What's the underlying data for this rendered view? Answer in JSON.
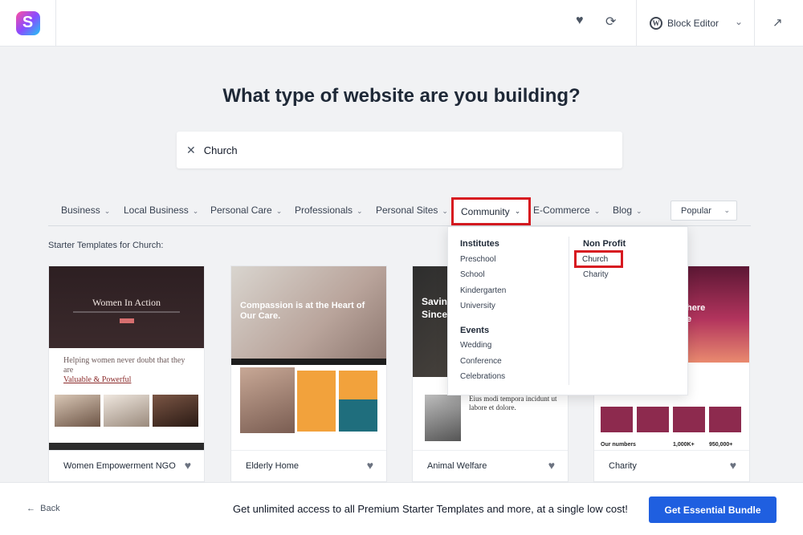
{
  "header": {
    "logo_letter": "S",
    "editor_label": "Block Editor",
    "icons": [
      "heart-icon",
      "sync-icon",
      "wordpress-icon",
      "chevron-down-icon",
      "external-link-icon"
    ]
  },
  "main": {
    "title": "What type of website are you building?",
    "search": {
      "value": "Church",
      "clear_icon": "close-icon"
    }
  },
  "categories": [
    {
      "label": "Business"
    },
    {
      "label": "Local Business"
    },
    {
      "label": "Personal Care"
    },
    {
      "label": "Professionals"
    },
    {
      "label": "Personal Sites"
    },
    {
      "label": "Community"
    },
    {
      "label": "E-Commerce"
    },
    {
      "label": "Blog"
    }
  ],
  "sort": {
    "selected": "Popular"
  },
  "results_label": "Starter Templates for Church:",
  "dropdown": {
    "columns": [
      {
        "groups": [
          {
            "heading": "Institutes",
            "items": [
              "Preschool",
              "School",
              "Kindergarten",
              "University"
            ]
          },
          {
            "heading": "Events",
            "items": [
              "Wedding",
              "Conference",
              "Celebrations"
            ]
          }
        ]
      },
      {
        "groups": [
          {
            "heading": "Non Profit",
            "items": [
              "Church",
              "Charity"
            ]
          }
        ]
      }
    ]
  },
  "cards": [
    {
      "title": "Women Empowerment NGO",
      "preview": {
        "hero": "Women In Action",
        "text_a": "Helping women never doubt that they are",
        "text_b": "Valuable & Powerful"
      }
    },
    {
      "title": "Elderly Home",
      "preview": {
        "hero": "Compassion is at the Heart of Our Care."
      }
    },
    {
      "title": "Animal Welfare",
      "preview": {
        "hero_a": "Savin",
        "hero_b": "Since",
        "text": "Eius modi tempora incidunt ut labore et dolore."
      }
    },
    {
      "title": "Charity",
      "preview": {
        "hero_a": "here",
        "hero_b": "e",
        "numbers_label": "Our numbers",
        "num_a": "1,000K+",
        "num_b": "950,000+"
      }
    }
  ],
  "colors": {
    "accent": "#1f5fe0",
    "highlight": "#d71920"
  },
  "footer": {
    "back_label": "Back",
    "promo": "Get unlimited access to all Premium Starter Templates and more, at a single low cost!",
    "cta_label": "Get Essential Bundle"
  }
}
